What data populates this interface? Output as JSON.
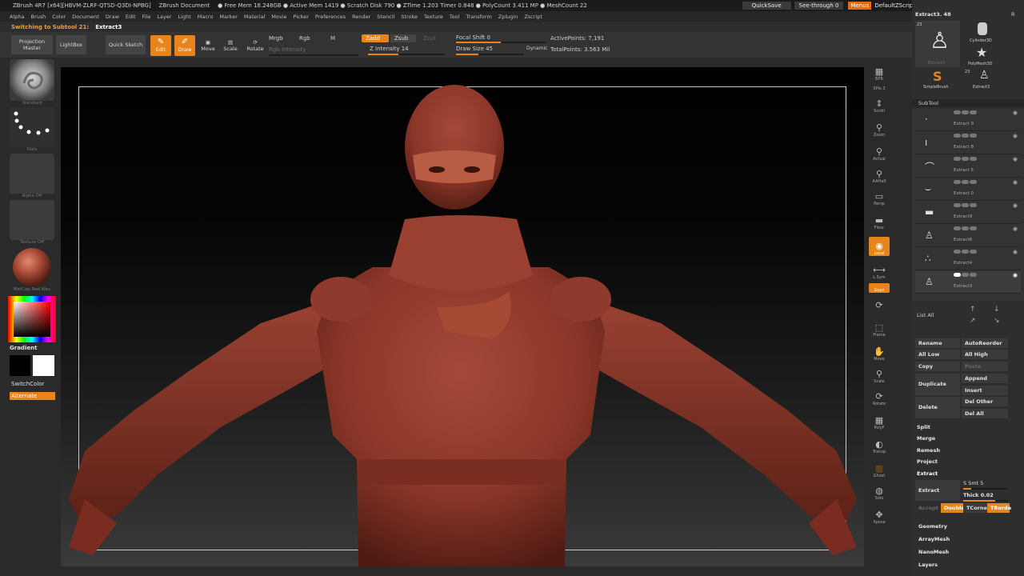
{
  "titlebar": {
    "items": [
      "ZBrush 4R7 [x64][HBVM-ZLRF-QTSD-Q3DI-NPBG]",
      "ZBrush Document",
      "● Free Mem 18.248GB ● Active Mem 1419 ● Scratch Disk 790 ● ZTime 1.203 Timer 0.848 ● PolyCount 3.411 MP ● MeshCount 22"
    ],
    "quicksave": "QuickSave",
    "seethrough": "See-through  0",
    "menus": "Menus",
    "default_zscript": "DefaultZScript",
    "win_buttons": [
      "?",
      "▭",
      "—",
      "▢",
      "✕"
    ]
  },
  "menubar": [
    "Alpha",
    "Brush",
    "Color",
    "Document",
    "Draw",
    "Edit",
    "File",
    "Layer",
    "Light",
    "Macro",
    "Marker",
    "Material",
    "Movie",
    "Picker",
    "Preferences",
    "Render",
    "Stencil",
    "Stroke",
    "Texture",
    "Tool",
    "Transform",
    "Zplugin",
    "Zscript"
  ],
  "status": {
    "message": "Switching to Subtool 21:",
    "value": "Extract3"
  },
  "toolbar": {
    "projection_master": "Projection Master",
    "lightbox": "LightBox",
    "quick_sketch": "Quick Sketch",
    "edit": "Edit",
    "draw": "Draw",
    "move": "Move",
    "scale": "Scale",
    "rotate": "Rotate",
    "mrgb": "Mrgb",
    "rgb": "Rgb",
    "m": "M",
    "rgb_intensity": "Rgb Intensity",
    "zadd": "Zadd",
    "zsub": "Zsub",
    "zcut": "Zcut",
    "z_intensity": "Z Intensity 14",
    "focal_shift": "Focal Shift 0",
    "draw_size": "Draw Size 45",
    "dynamic": "Dynamic",
    "active_points": "ActivePoints: 7,191",
    "total_points": "TotalPoints: 3.563 Mil"
  },
  "leftshelf": {
    "brush_caption": "Standard",
    "stroke_caption": "Dots",
    "alpha_caption": "Alpha Off",
    "texture_caption": "Texture Off",
    "material_caption": "MatCap Red Wax",
    "gradient": "Gradient",
    "switch_color": "SwitchColor",
    "alternate": "Alternate"
  },
  "rightshelf": {
    "buttons": [
      {
        "icon": "▦",
        "label": "BPR"
      },
      {
        "icon": "",
        "label": "SPix 3"
      },
      {
        "icon": "⇕",
        "label": "Scroll"
      },
      {
        "icon": "⚲",
        "label": "Zoom"
      },
      {
        "icon": "⚲",
        "label": "Actual"
      },
      {
        "icon": "⚲",
        "label": "AAHalf"
      },
      {
        "icon": "▭",
        "label": "Persp"
      },
      {
        "icon": "▬",
        "label": "Floor"
      },
      {
        "icon": "◉",
        "label": "Local"
      },
      {
        "icon": "⟷",
        "label": "L.Sym"
      },
      {
        "icon": "◎",
        "label": "Gxyz"
      },
      {
        "icon": "⟳",
        "label": ""
      },
      {
        "icon": "⬚",
        "label": "Frame"
      },
      {
        "icon": "✋",
        "label": "Move"
      },
      {
        "icon": "⚲",
        "label": "Scale"
      },
      {
        "icon": "⟳",
        "label": "Rotate"
      },
      {
        "icon": "▦",
        "label": "PolyF"
      },
      {
        "icon": "◐",
        "label": "Transp"
      },
      {
        "icon": "▩",
        "label": "Ghost"
      },
      {
        "icon": "◍",
        "label": "Solo"
      },
      {
        "icon": "✥",
        "label": "Xpose"
      }
    ]
  },
  "rightpanel": {
    "tool_name": "Extract3. 48",
    "r_label": "R",
    "tool_thumbs": [
      {
        "label": "Extract3",
        "badge": "23"
      },
      {
        "label": "Cylinder3D",
        "badge": ""
      },
      {
        "label": "PolyMesh3D",
        "badge": ""
      },
      {
        "label": "SimpleBrush",
        "badge": ""
      },
      {
        "label": "Extract3",
        "badge": "23"
      }
    ],
    "subtool_title": "SubTool",
    "subtools": [
      "Extract 9",
      "Extract 8",
      "Extract 5",
      "Extract 0",
      "Extract9",
      "Extract6",
      "Extract4",
      "Extract3"
    ],
    "list_all": "List All",
    "rename": "Rename",
    "autoreorder": "AutoReorder",
    "all_low": "All Low",
    "all_high": "All High",
    "copy": "Copy",
    "paste": "Paste",
    "duplicate": "Duplicate",
    "append": "Append",
    "insert": "Insert",
    "delete": "Delete",
    "del_other": "Del Other",
    "del_all": "Del All",
    "split": "Split",
    "merge": "Merge",
    "remesh": "Remesh",
    "project": "Project",
    "extract_section": "Extract",
    "extract_button": "Extract",
    "s_smt": "S Smt 5",
    "thick": "Thick 0.02",
    "accept": "Accept",
    "double": "Double",
    "tcorne": "TCorne",
    "tborde": "TBorde",
    "geometry": "Geometry",
    "arraymesh": "ArrayMesh",
    "nanomesh": "NanoMesh",
    "layers": "Layers"
  },
  "colors": {
    "accent": "#e8841c",
    "model": "#8a3628",
    "background": "#2a2a2a"
  }
}
